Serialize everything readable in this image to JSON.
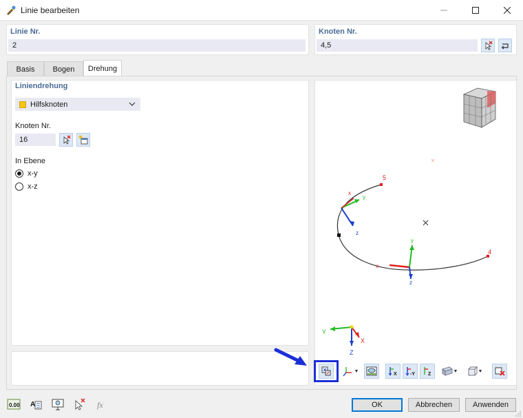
{
  "window": {
    "title": "Linie bearbeiten",
    "minimize_icon": "minimize-icon",
    "maximize_icon": "maximize-icon",
    "close_icon": "close-icon"
  },
  "line_group": {
    "label": "Linie Nr.",
    "value": "2"
  },
  "nodes_group": {
    "label": "Knoten Nr.",
    "value": "4,5",
    "pick_icon": "pick-nodes-icon",
    "reverse_icon": "reverse-direction-icon"
  },
  "tabs": [
    {
      "label": "Basis",
      "active": false
    },
    {
      "label": "Bogen",
      "active": false
    },
    {
      "label": "Drehung",
      "active": true
    }
  ],
  "rotation": {
    "section_title": "Liniendrehung",
    "type_selected": "Hilfsknoten",
    "type_color": "#f5c518",
    "node_label": "Knoten Nr.",
    "node_value": "16",
    "pick_icon": "pick-node-icon",
    "new_node_icon": "new-node-icon",
    "plane_label": "In Ebene",
    "plane_options": [
      {
        "label": "x-y",
        "checked": true
      },
      {
        "label": "x-z",
        "checked": false
      }
    ]
  },
  "preview": {
    "node_labels": [
      "5",
      "4"
    ],
    "local_axes": [
      "x",
      "y",
      "z"
    ],
    "global_axes": [
      "Y",
      "X",
      "Z"
    ],
    "colors": {
      "x_axis": "#e02020",
      "y_axis": "#22bb22",
      "z_axis": "#1a3fd0",
      "curve": "#333333"
    }
  },
  "view_toolbar": {
    "icons": [
      "rotate-view-icon",
      "coordinate-system-icon",
      "render-mode-icon",
      "view-x-icon",
      "view-y-icon",
      "view-z-icon",
      "display-options-icon",
      "box-view-icon",
      "reset-view-icon"
    ],
    "highlighted": "rotate-view-icon",
    "highlight_color": "#1b2fd8"
  },
  "footer": {
    "icons": [
      "units-icon",
      "edit-label-icon",
      "view-icon",
      "delete-icon",
      "formula-icon"
    ],
    "ok": "OK",
    "cancel": "Abbrechen",
    "apply": "Anwenden"
  }
}
